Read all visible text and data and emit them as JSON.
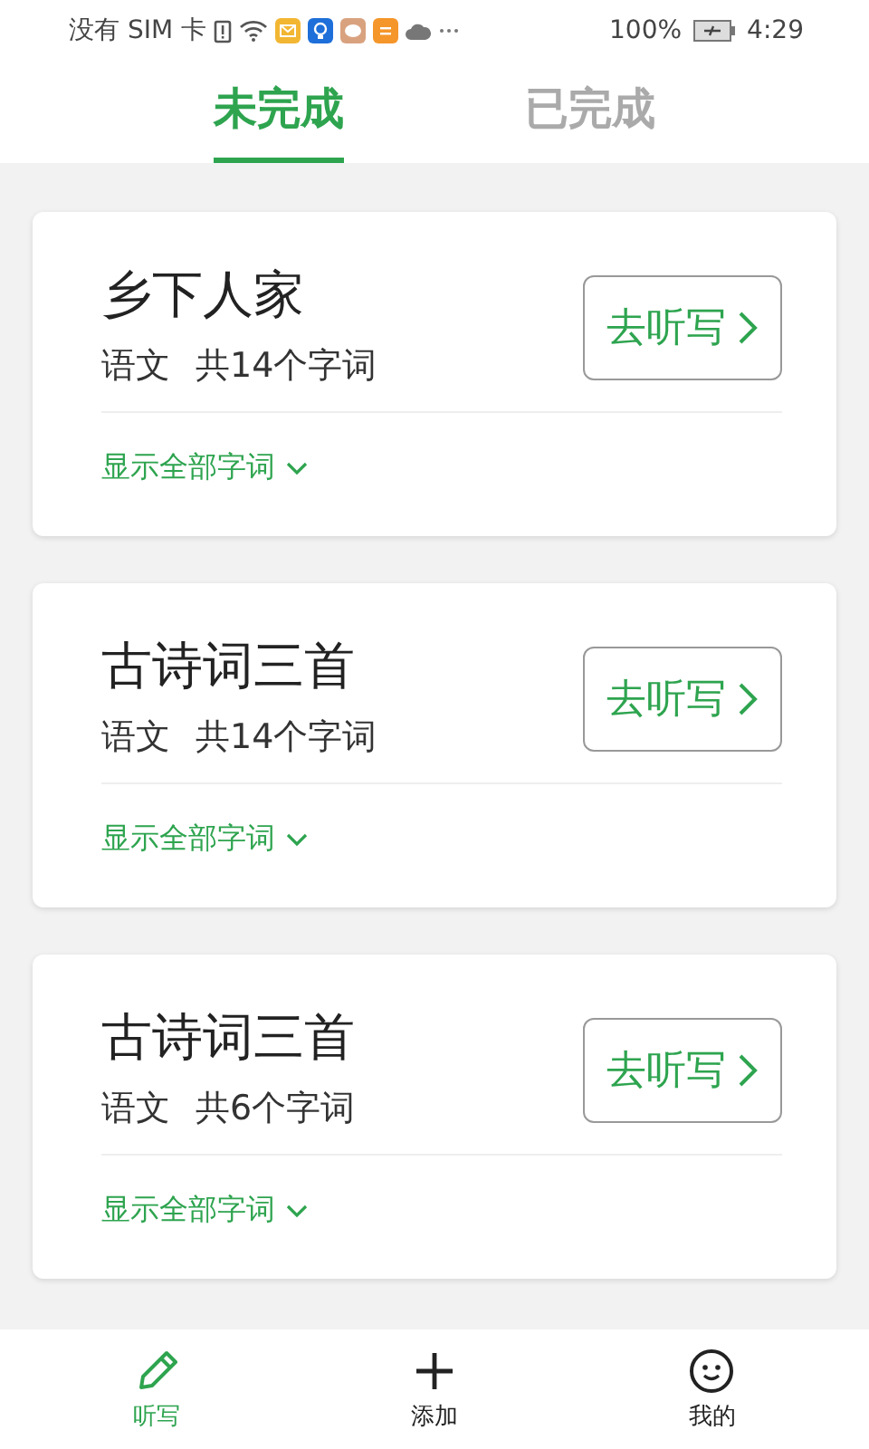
{
  "status_bar": {
    "carrier": "没有 SIM 卡",
    "battery": "100%",
    "time": "4:29"
  },
  "tabs": [
    {
      "label": "未完成",
      "selected": true
    },
    {
      "label": "已完成",
      "selected": false
    }
  ],
  "cards": [
    {
      "title": "乡下人家",
      "subject": "语文",
      "count": "共14个字词",
      "button": "去听写",
      "toggle": "显示全部字词"
    },
    {
      "title": "古诗词三首",
      "subject": "语文",
      "count": "共14个字词",
      "button": "去听写",
      "toggle": "显示全部字词"
    },
    {
      "title": "古诗词三首",
      "subject": "语文",
      "count": "共6个字词",
      "button": "去听写",
      "toggle": "显示全部字词"
    }
  ],
  "bottom_nav": [
    {
      "kind": "pencil",
      "label": "听写",
      "selected": true
    },
    {
      "kind": "plus",
      "label": "添加",
      "selected": false
    },
    {
      "kind": "face",
      "label": "我的",
      "selected": false
    }
  ]
}
